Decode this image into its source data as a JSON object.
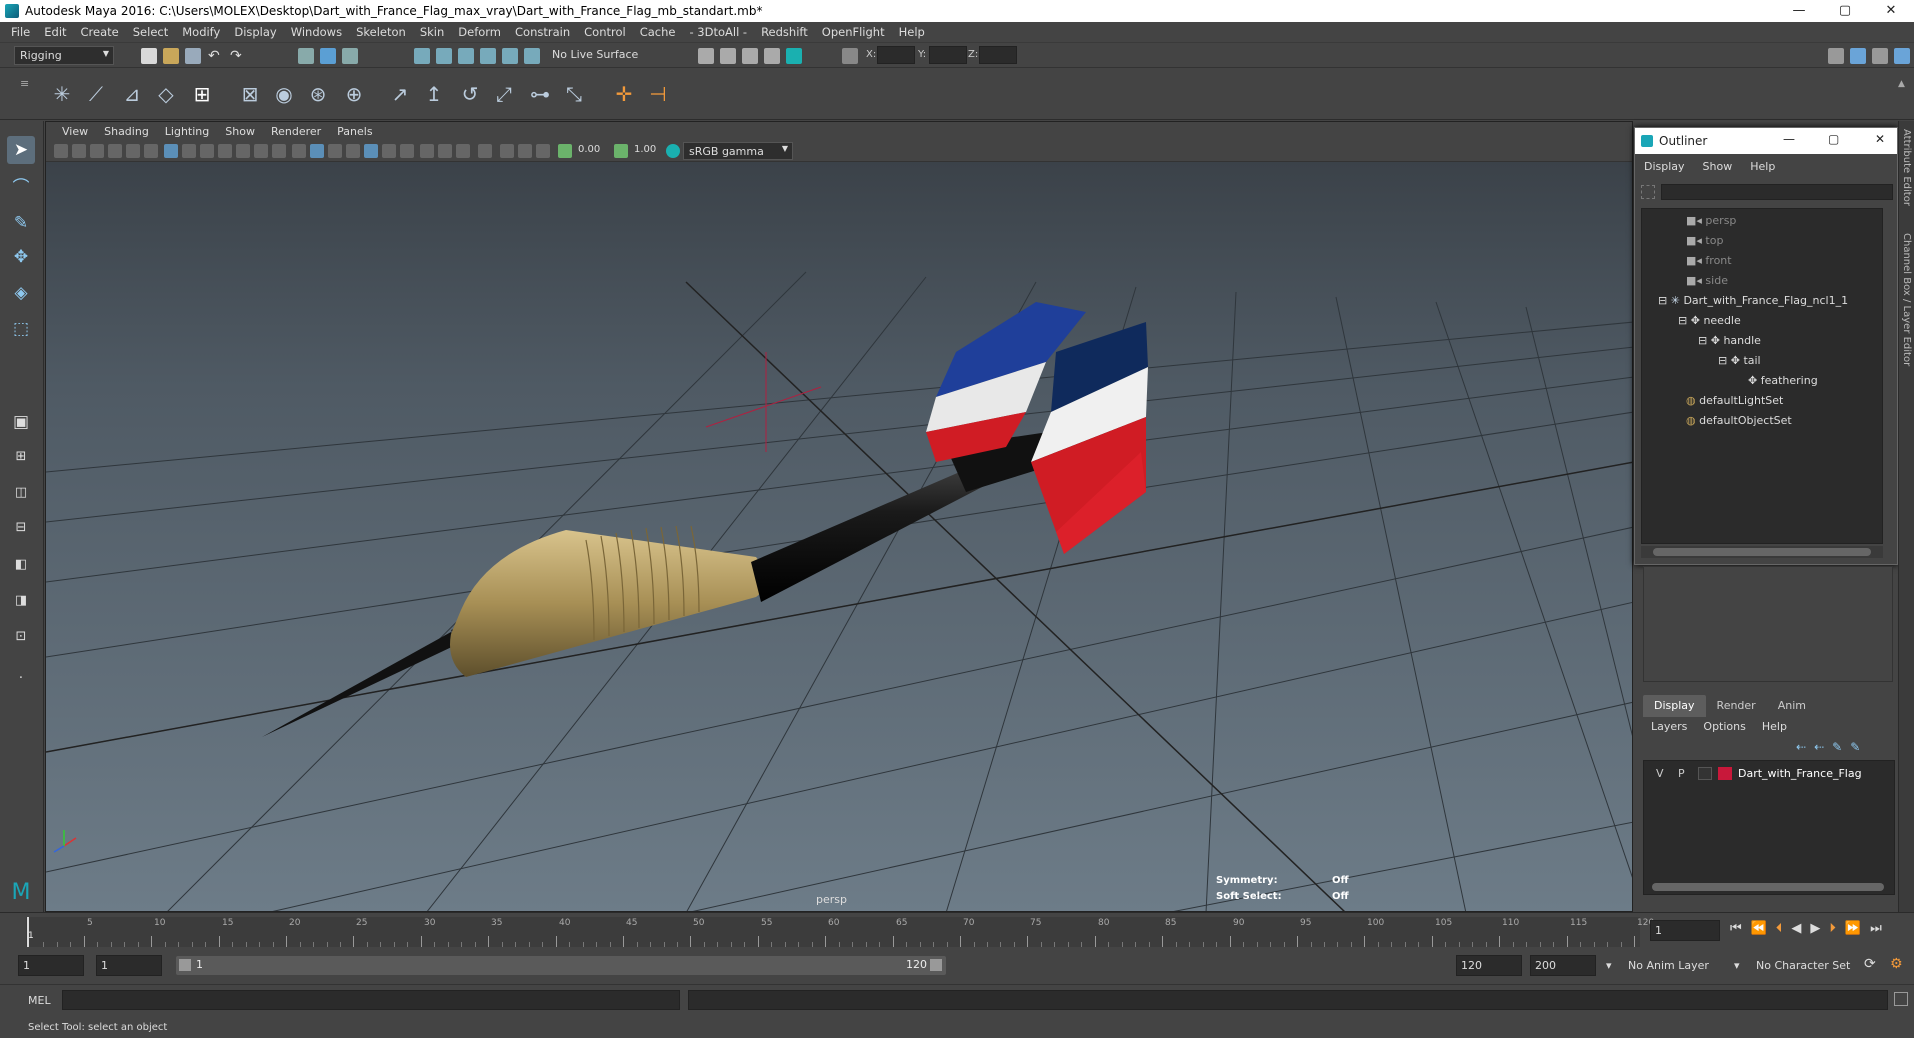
{
  "window": {
    "title": "Autodesk Maya 2016: C:\\Users\\MOLEX\\Desktop\\Dart_with_France_Flag_max_vray\\Dart_with_France_Flag_mb_standart.mb*",
    "min": "—",
    "max": "▢",
    "close": "✕"
  },
  "menubar": [
    "File",
    "Edit",
    "Create",
    "Select",
    "Modify",
    "Display",
    "Windows",
    "Skeleton",
    "Skin",
    "Deform",
    "Constrain",
    "Control",
    "Cache",
    "- 3DtoAll -",
    "Redshift",
    "OpenFlight",
    "Help"
  ],
  "statusline": {
    "menuset": "Rigging",
    "live_surface": "No Live Surface",
    "x_label": "X:",
    "y_label": "Y:",
    "z_label": "Z:"
  },
  "viewport": {
    "menu": [
      "View",
      "Shading",
      "Lighting",
      "Show",
      "Renderer",
      "Panels"
    ],
    "exposure": "0.00",
    "gamma": "1.00",
    "colorspace": "sRGB gamma",
    "camera": "persp",
    "hud": {
      "symmetry_label": "Symmetry:",
      "symmetry_value": "Off",
      "softselect_label": "Soft Select:",
      "softselect_value": "Off"
    }
  },
  "outliner": {
    "title": "Outliner",
    "menu": [
      "Display",
      "Show",
      "Help"
    ],
    "items": [
      {
        "label": "persp",
        "dim": true
      },
      {
        "label": "top",
        "dim": true
      },
      {
        "label": "front",
        "dim": true
      },
      {
        "label": "side",
        "dim": true
      },
      {
        "label": "Dart_with_France_Flag_ncl1_1",
        "dim": false
      },
      {
        "label": "needle",
        "dim": false
      },
      {
        "label": "handle",
        "dim": false
      },
      {
        "label": "tail",
        "dim": false
      },
      {
        "label": "feathering",
        "dim": false
      },
      {
        "label": "defaultLightSet",
        "dim": false
      },
      {
        "label": "defaultObjectSet",
        "dim": false
      }
    ]
  },
  "layers": {
    "tabs": [
      "Display",
      "Render",
      "Anim"
    ],
    "menu": [
      "Layers",
      "Options",
      "Help"
    ],
    "row": {
      "v": "V",
      "p": "P",
      "name": "Dart_with_France_Flag",
      "color": "#c8183a"
    }
  },
  "side_tabs": [
    "Attribute Editor",
    "Channel Box / Layer Editor"
  ],
  "timeline": {
    "ticks": [
      "5",
      "10",
      "15",
      "20",
      "25",
      "30",
      "35",
      "40",
      "45",
      "50",
      "55",
      "60",
      "65",
      "70",
      "75",
      "80",
      "85",
      "90",
      "95",
      "100",
      "105",
      "110",
      "115",
      "120"
    ],
    "start_label": "1",
    "current_frame": "1"
  },
  "range": {
    "start": "1",
    "playback_start": "1",
    "slider_start": "1",
    "slider_end": "120",
    "playback_end": "120",
    "end": "200",
    "anim_layer": "No Anim Layer",
    "character_set": "No Character Set"
  },
  "cmd": {
    "label": "MEL"
  },
  "help": {
    "text": "Select Tool: select an object"
  },
  "colors": {
    "flag_blue": "#1f3f9a",
    "flag_white": "#e8e8e8",
    "flag_red": "#d01c24",
    "brass": "#b09a62"
  }
}
